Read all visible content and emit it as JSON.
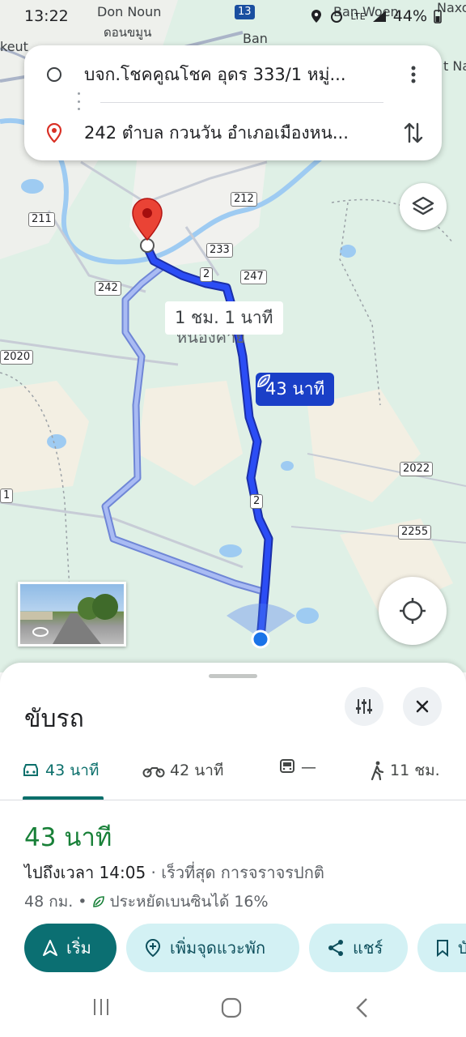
{
  "status_bar": {
    "time": "13:22",
    "battery": "44%",
    "network": "LTE"
  },
  "map": {
    "labels": [
      "Don Noun",
      "ดอนขมูน",
      "Ban",
      "Ban Woen",
      "Naxo",
      "keut",
      "t Na",
      "หนองคาย"
    ],
    "shields": [
      "212",
      "211",
      "233",
      "2",
      "247",
      "242",
      "2020",
      "2022",
      "2",
      "2255",
      "13",
      "1"
    ],
    "route_time_alt": "1 ชม. 1 นาที",
    "route_time_main": "43 นาที"
  },
  "route": {
    "origin": "บจก.โชคคูณโชค อุดร 333/1 หมู่...",
    "destination": "242 ตำบล กวนวัน อำเภอเมืองหน..."
  },
  "sheet": {
    "title": "ขับรถ",
    "modes": [
      {
        "icon": "car-icon",
        "label": "43 นาที"
      },
      {
        "icon": "motorcycle-icon",
        "label": "42 นาที"
      },
      {
        "icon": "transit-icon",
        "label": "—"
      },
      {
        "icon": "walk-icon",
        "label": "11 ชม."
      }
    ],
    "duration": "43 นาที",
    "arrival": "ไปถึงเวลา 14:05",
    "arrival_note": " · เร็วที่สุด การจราจรปกติ",
    "distance": "48 กม.",
    "bullet": "•",
    "eco": "ประหยัดเบนซินได้ 16%",
    "actions": {
      "start": "เริ่ม",
      "add_stop": "เพิ่มจุดแวะพัก",
      "share": "แชร์",
      "save": "บันทึก"
    }
  },
  "colors": {
    "route_main": "#1a3fc7",
    "route_alt": "#9fb4f0",
    "accent": "#0b6f72",
    "duration": "#188038"
  }
}
